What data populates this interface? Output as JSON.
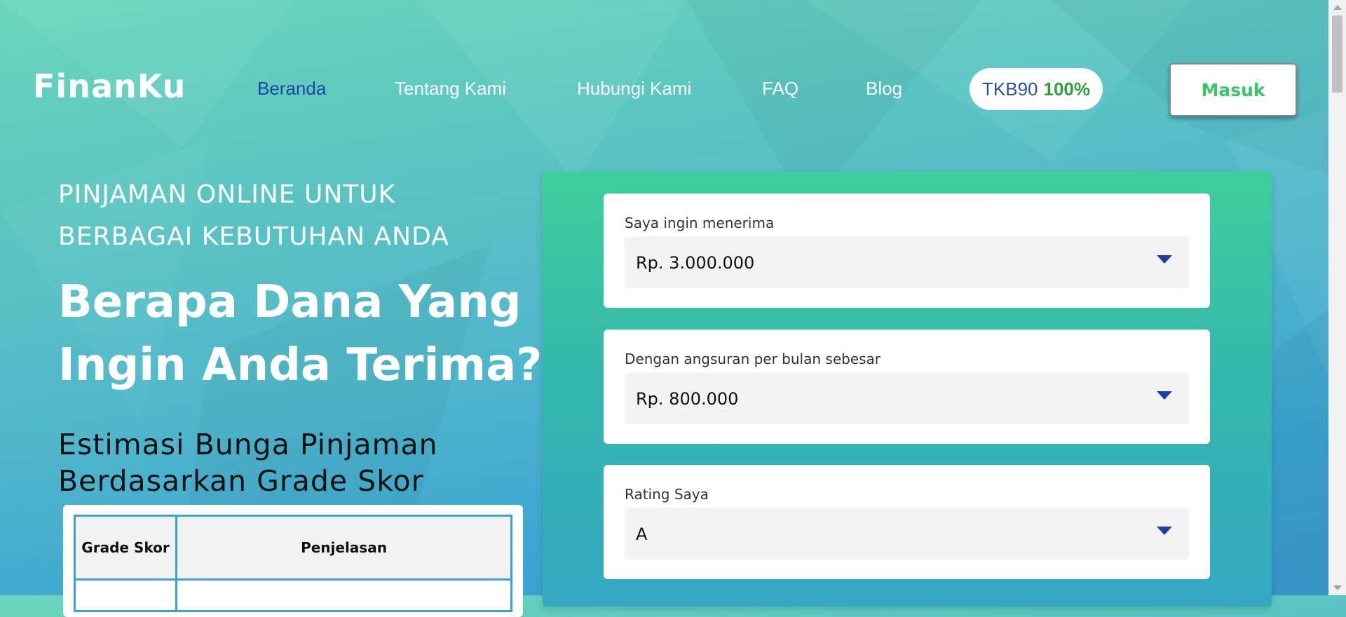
{
  "brand": {
    "logo_text": "FinanKu"
  },
  "nav": {
    "items": [
      {
        "label": "Beranda",
        "active": true
      },
      {
        "label": "Tentang Kami",
        "active": false
      },
      {
        "label": "Hubungi Kami",
        "active": false
      },
      {
        "label": "FAQ",
        "active": false
      },
      {
        "label": "Blog",
        "active": false
      }
    ],
    "tkb": {
      "label": "TKB90",
      "value": "100%"
    },
    "login_label": "Masuk"
  },
  "hero": {
    "kicker": "PINJAMAN ONLINE UNTUK BERBAGAI KEBUTUHAN ANDA",
    "headline": "Berapa Dana Yang Ingin Anda Terima?",
    "subhead": "Estimasi Bunga Pinjaman Berdasarkan Grade Skor"
  },
  "grade_table": {
    "headers": [
      "Grade Skor",
      "Penjelasan"
    ]
  },
  "calculator": {
    "fields": [
      {
        "label": "Saya ingin menerima",
        "value": "Rp. 3.000.000"
      },
      {
        "label": "Dengan angsuran per bulan sebesar",
        "value": "Rp. 800.000"
      },
      {
        "label": "Rating Saya",
        "value": "A"
      }
    ]
  },
  "colors": {
    "accent_blue": "#1d46a8",
    "accent_green": "#3cc466",
    "tkb_green": "#2e9e3e",
    "table_border": "#3fa2d4"
  }
}
